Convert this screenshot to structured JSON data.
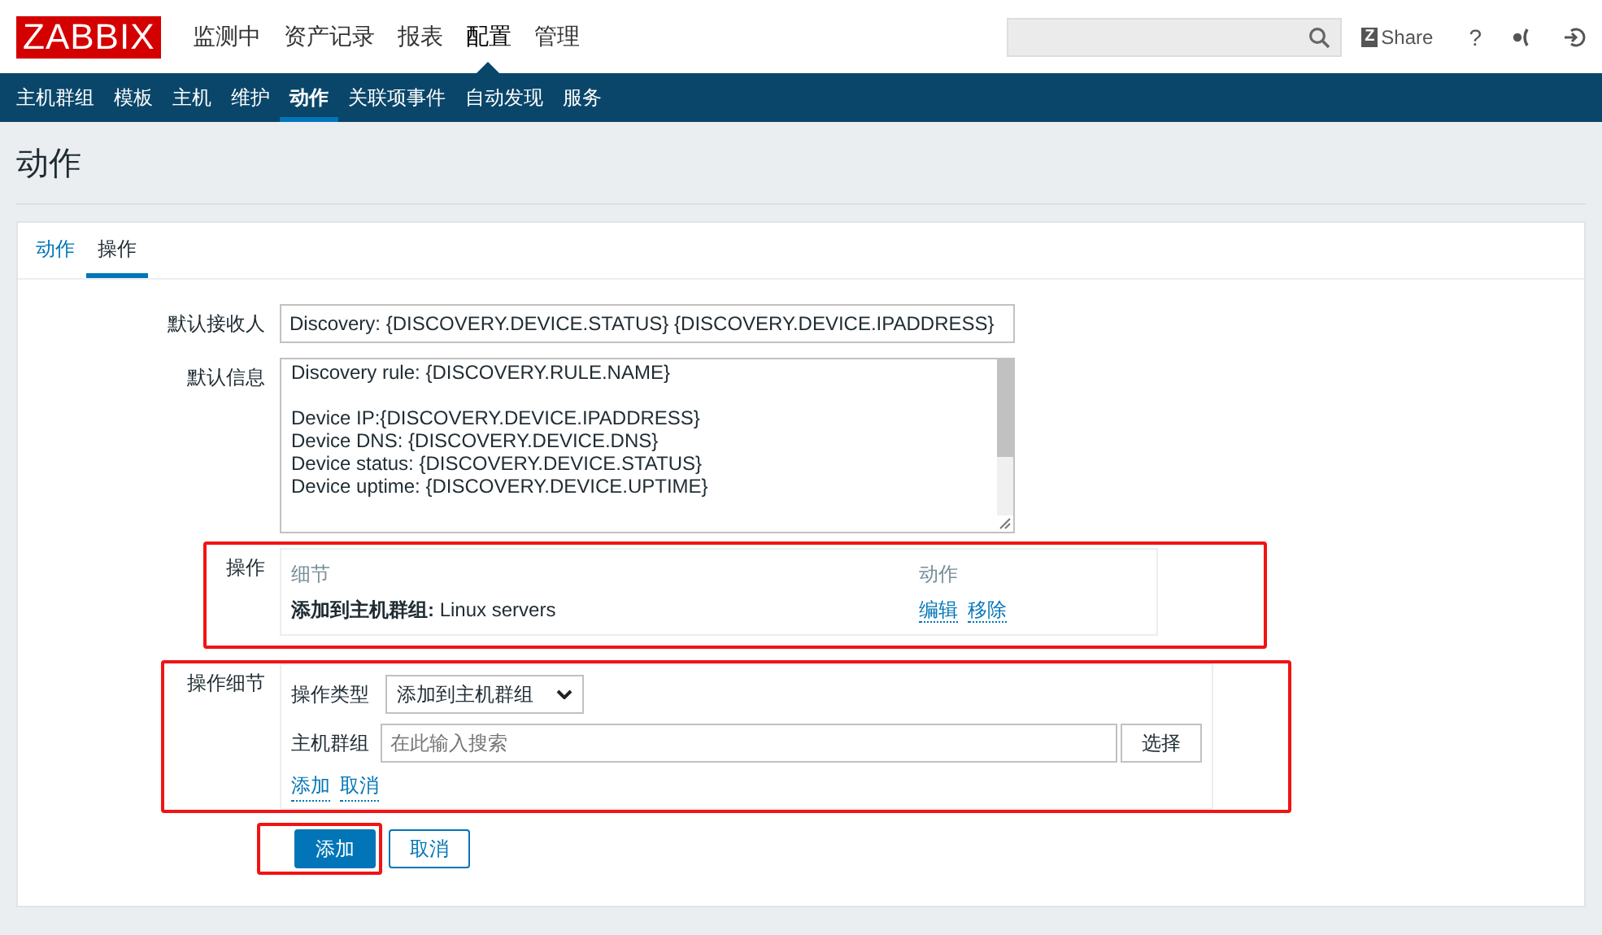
{
  "header": {
    "logo": "ZABBIX",
    "menu": [
      {
        "label": "监测中",
        "selected": false
      },
      {
        "label": "资产记录",
        "selected": false
      },
      {
        "label": "报表",
        "selected": false
      },
      {
        "label": "配置",
        "selected": true
      },
      {
        "label": "管理",
        "selected": false
      }
    ],
    "share_icon": "Z",
    "share": "Share",
    "help": "?"
  },
  "submenu": [
    {
      "label": "主机群组",
      "selected": false
    },
    {
      "label": "模板",
      "selected": false
    },
    {
      "label": "主机",
      "selected": false
    },
    {
      "label": "维护",
      "selected": false
    },
    {
      "label": "动作",
      "selected": true
    },
    {
      "label": "关联项事件",
      "selected": false
    },
    {
      "label": "自动发现",
      "selected": false
    },
    {
      "label": "服务",
      "selected": false
    }
  ],
  "page_title": "动作",
  "tabs": [
    {
      "label": "动作",
      "selected": false
    },
    {
      "label": "操作",
      "selected": true
    }
  ],
  "form": {
    "default_subject": {
      "label": "默认接收人",
      "value": "Discovery: {DISCOVERY.DEVICE.STATUS} {DISCOVERY.DEVICE.IPADDRESS}"
    },
    "default_message": {
      "label": "默认信息",
      "paragraphs": [
        [
          "Discovery rule: {DISCOVERY.RULE.NAME}"
        ],
        [
          "Device IP:{DISCOVERY.DEVICE.IPADDRESS}",
          "Device DNS: {DISCOVERY.DEVICE.DNS}",
          "Device status: {DISCOVERY.DEVICE.STATUS}",
          "Device uptime: {DISCOVERY.DEVICE.UPTIME}"
        ]
      ]
    },
    "operations": {
      "label": "操作",
      "highlighted": true,
      "columns": [
        "细节",
        "动作"
      ],
      "rows": [
        {
          "detail_bold": "添加到主机群组:",
          "detail": "Linux servers",
          "actions": [
            "编辑",
            "移除"
          ]
        }
      ]
    },
    "operation_details": {
      "label": "操作细节",
      "highlighted": true,
      "type_label": "操作类型",
      "type_value": "添加到主机群组",
      "group_label": "主机群组",
      "group_placeholder": "在此输入搜索",
      "select_button": "选择",
      "links": [
        "添加",
        "取消"
      ]
    },
    "buttons": [
      {
        "label": "添加",
        "kind": "primary",
        "highlighted": true
      },
      {
        "label": "取消",
        "kind": "secondary",
        "highlighted": false
      }
    ]
  }
}
